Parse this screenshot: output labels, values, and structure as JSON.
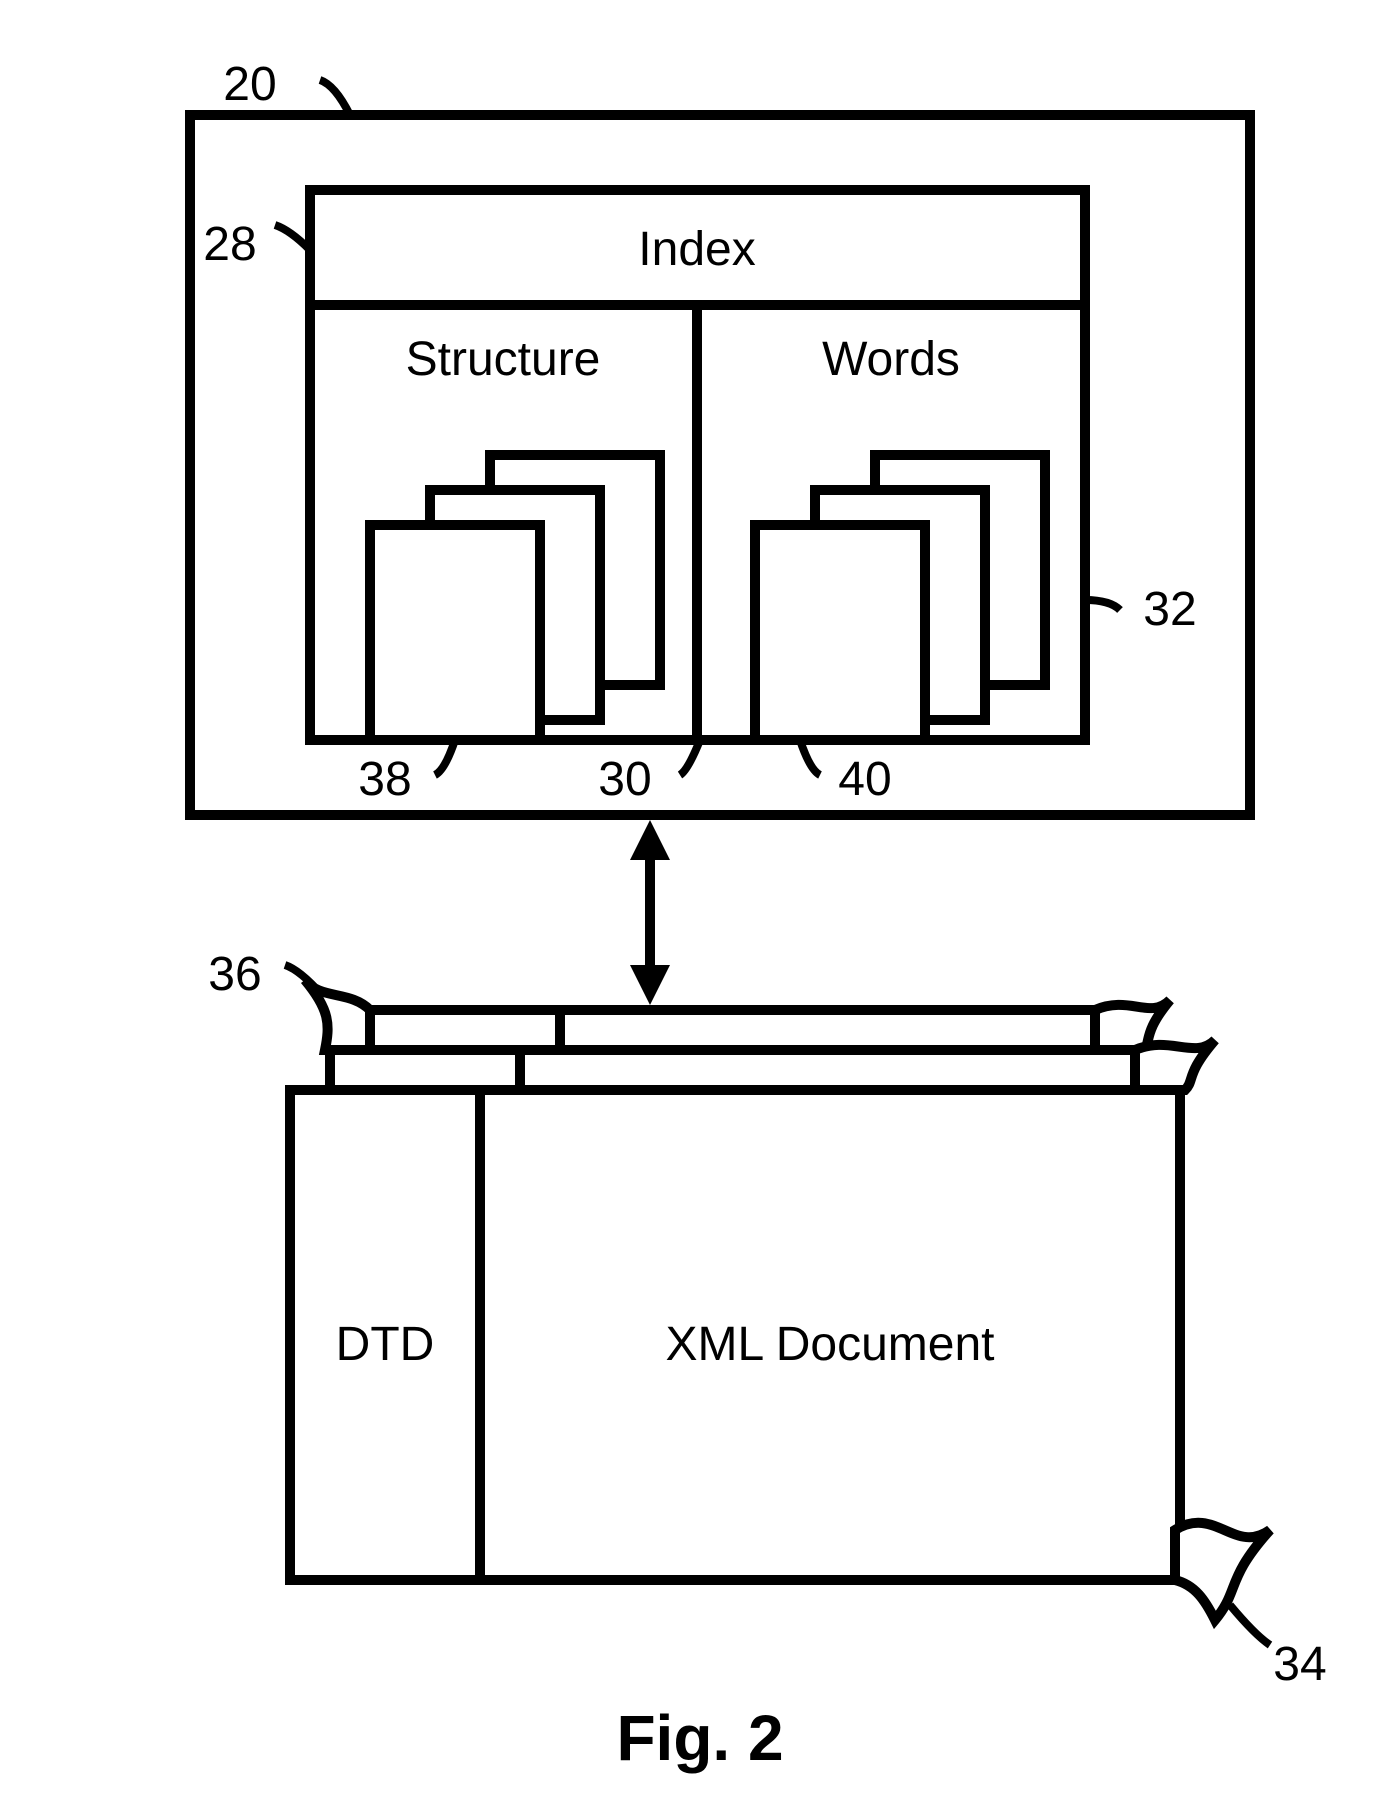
{
  "figure": {
    "caption": "Fig. 2",
    "refs": {
      "outer": "20",
      "index": "28",
      "structure_col": "30",
      "words_col": "32",
      "xml_stack": "34",
      "dtd_stack": "36",
      "structure_docs": "38",
      "words_docs": "40"
    },
    "labels": {
      "index": "Index",
      "structure": "Structure",
      "words": "Words",
      "dtd": "DTD",
      "xml": "XML Document"
    }
  }
}
